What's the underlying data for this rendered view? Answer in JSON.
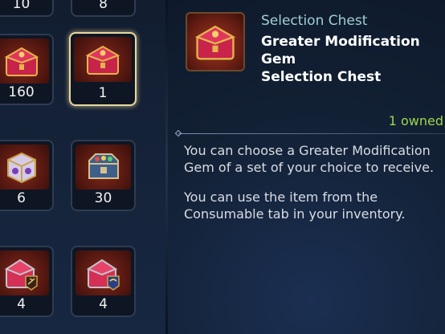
{
  "inventory": {
    "top_partial": [
      "10",
      "8"
    ],
    "rows": [
      [
        {
          "quantity": "160",
          "icon": "red-gold-chest-icon",
          "selected": false
        },
        {
          "quantity": "1",
          "icon": "red-gold-chest-icon",
          "selected": true
        }
      ],
      [
        {
          "quantity": "6",
          "icon": "purple-gold-cube-chest-icon",
          "selected": false
        },
        {
          "quantity": "30",
          "icon": "ornate-blue-chest-icon",
          "selected": false
        }
      ],
      [
        {
          "quantity": "4",
          "icon": "red-chest-with-emblem-icon",
          "selected": false
        },
        {
          "quantity": "4",
          "icon": "red-chest-with-blue-emblem-icon",
          "selected": false
        }
      ]
    ]
  },
  "detail": {
    "category": "Selection Chest",
    "name_line1": "Greater Modification Gem",
    "name_line2": "Selection Chest",
    "owned": "1 owned",
    "description": [
      "You can choose a Greater Modification",
      "Gem of a set of your choice to receive.",
      "You can use the item from the",
      "Consumable tab in your inventory."
    ]
  },
  "colors": {
    "accent_gold": "#e8d7a0",
    "owned_green": "#9bd64a",
    "category_cyan": "#9fd0d8"
  }
}
